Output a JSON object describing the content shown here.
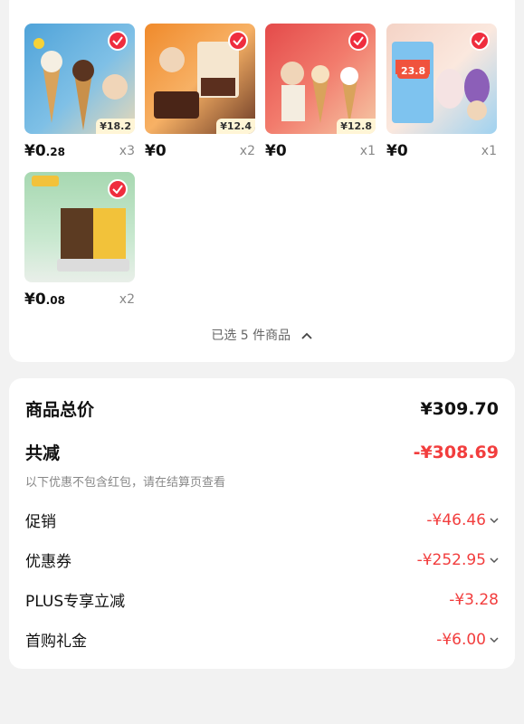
{
  "products": [
    {
      "price_main": "¥0",
      "price_decimal": ".28",
      "qty": "x3",
      "tag": "¥18.2",
      "bg1": "#4fa3d9",
      "bg2": "#e9d9b7"
    },
    {
      "price_main": "¥0",
      "price_decimal": "",
      "qty": "x2",
      "tag": "¥12.4",
      "bg1": "#f08a2b",
      "bg2": "#6b3a26"
    },
    {
      "price_main": "¥0",
      "price_decimal": "",
      "qty": "x1",
      "tag": "¥12.8",
      "bg1": "#e44a4a",
      "bg2": "#f5c9a6"
    },
    {
      "price_main": "¥0",
      "price_decimal": "",
      "qty": "x1",
      "tag": "23.8",
      "bg1": "#f4d3c6",
      "bg2": "#9fd2f0"
    },
    {
      "price_main": "¥0",
      "price_decimal": ".08",
      "qty": "x2",
      "tag": "",
      "bg1": "#a7d8b1",
      "bg2": "#f2c23a"
    }
  ],
  "selected_text": "已选 5 件商品",
  "summary": {
    "total_label": "商品总价",
    "total_value": "¥309.70",
    "reduce_label": "共减",
    "reduce_value": "-¥308.69",
    "note": "以下优惠不包含红包，请在结算页查看",
    "items": [
      {
        "label": "促销",
        "value": "-¥46.46"
      },
      {
        "label": "优惠券",
        "value": "-¥252.95"
      },
      {
        "label": "PLUS专享立减",
        "value": "-¥3.28"
      },
      {
        "label": "首购礼金",
        "value": "-¥6.00"
      }
    ]
  },
  "colors": {
    "accent": "#f23d3d",
    "check": "#ef2d3e"
  }
}
